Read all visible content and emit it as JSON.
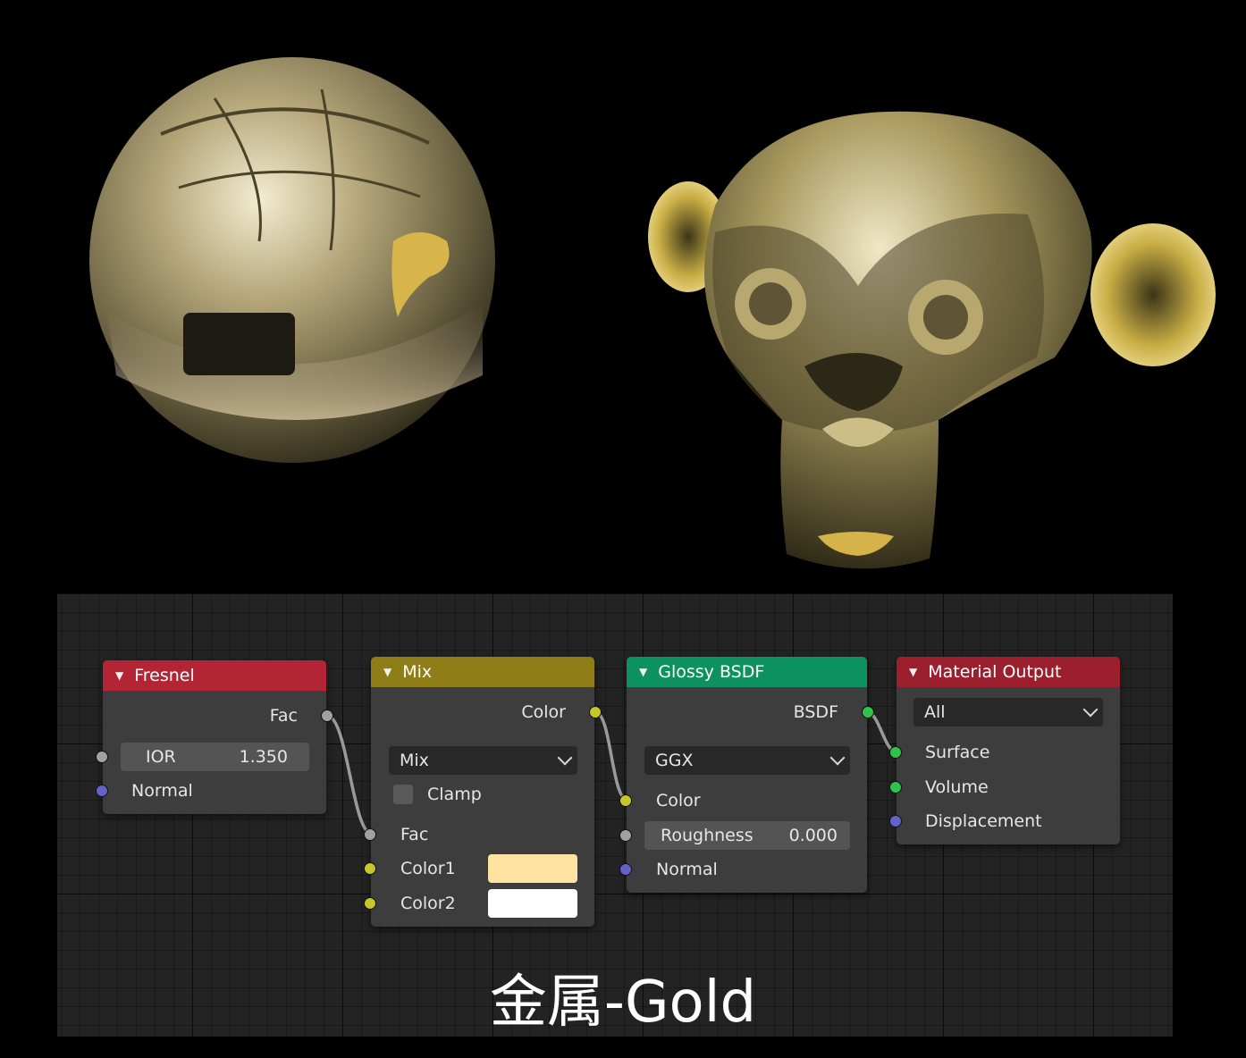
{
  "caption": "金属-Gold",
  "colors": {
    "fresnel_header": "#b32535",
    "mix_header": "#8f7d18",
    "glossy_header": "#0d9160",
    "output_header": "#9c1f2e",
    "color1": "#ffe3a0",
    "color2": "#ffffff"
  },
  "nodes": {
    "fresnel": {
      "title": "Fresnel",
      "output_fac": "Fac",
      "ior_label": "IOR",
      "ior_value": "1.350",
      "normal": "Normal"
    },
    "mix": {
      "title": "Mix",
      "output_color": "Color",
      "blend_mode": "Mix",
      "clamp": "Clamp",
      "fac": "Fac",
      "color1": "Color1",
      "color2": "Color2"
    },
    "glossy": {
      "title": "Glossy BSDF",
      "output_bsdf": "BSDF",
      "distribution": "GGX",
      "color": "Color",
      "roughness_label": "Roughness",
      "roughness_value": "0.000",
      "normal": "Normal"
    },
    "output": {
      "title": "Material Output",
      "target": "All",
      "surface": "Surface",
      "volume": "Volume",
      "displacement": "Displacement"
    }
  }
}
